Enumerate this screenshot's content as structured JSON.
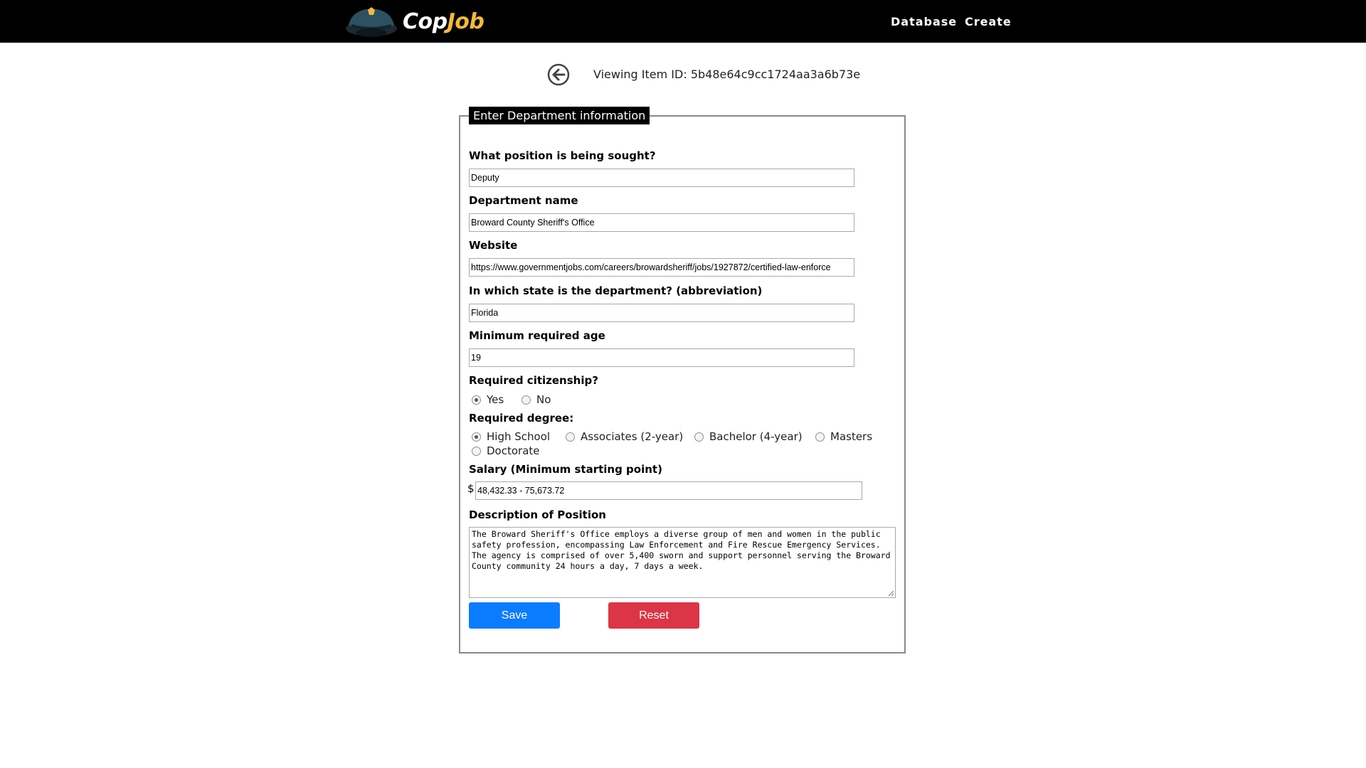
{
  "brand": {
    "cop": "Cop",
    "job": "Job",
    "logo_icon": "police-cap-icon"
  },
  "nav": {
    "database": "Database",
    "create": "Create"
  },
  "viewing": {
    "text": "Viewing Item ID: 5b48e64c9cc1724aa3a6b73e",
    "back_icon": "back-arrow-circle-icon"
  },
  "form": {
    "legend": "Enter Department information",
    "position": {
      "label": "What position is being sought?",
      "value": "Deputy"
    },
    "department": {
      "label": "Department name",
      "value": "Broward County Sheriff's Office"
    },
    "website": {
      "label": "Website",
      "value": "https://www.governmentjobs.com/careers/browardsheriff/jobs/1927872/certified-law-enforce"
    },
    "state": {
      "label": "In which state is the department? (abbreviation)",
      "value": "Florida"
    },
    "age": {
      "label": "Minimum required age",
      "value": "19"
    },
    "citizenship": {
      "label": "Required citizenship?",
      "options": [
        {
          "label": "Yes",
          "checked": true
        },
        {
          "label": "No",
          "checked": false
        }
      ]
    },
    "degree": {
      "label": "Required degree:",
      "options": [
        {
          "label": "High School",
          "checked": true
        },
        {
          "label": "Associates (2-year)",
          "checked": false
        },
        {
          "label": "Bachelor (4-year)",
          "checked": false
        },
        {
          "label": "Masters",
          "checked": false
        },
        {
          "label": "Doctorate",
          "checked": false
        }
      ]
    },
    "salary": {
      "label": "Salary (Minimum starting point)",
      "currency": "$",
      "value": "48,432.33 - 75,673.72"
    },
    "description": {
      "label": "Description of Position",
      "value": "The Broward Sheriff's Office employs a diverse group of men and women in the public safety profession, encompassing Law Enforcement and Fire Rescue Emergency Services. The agency is comprised of over 5,400 sworn and support personnel serving the Broward County community 24 hours a day, 7 days a week."
    },
    "save_label": "Save",
    "reset_label": "Reset"
  },
  "colors": {
    "header_bg": "#000000",
    "brand_accent": "#f5b83d",
    "save_button": "#0b7cff",
    "reset_button": "#dc3545"
  }
}
